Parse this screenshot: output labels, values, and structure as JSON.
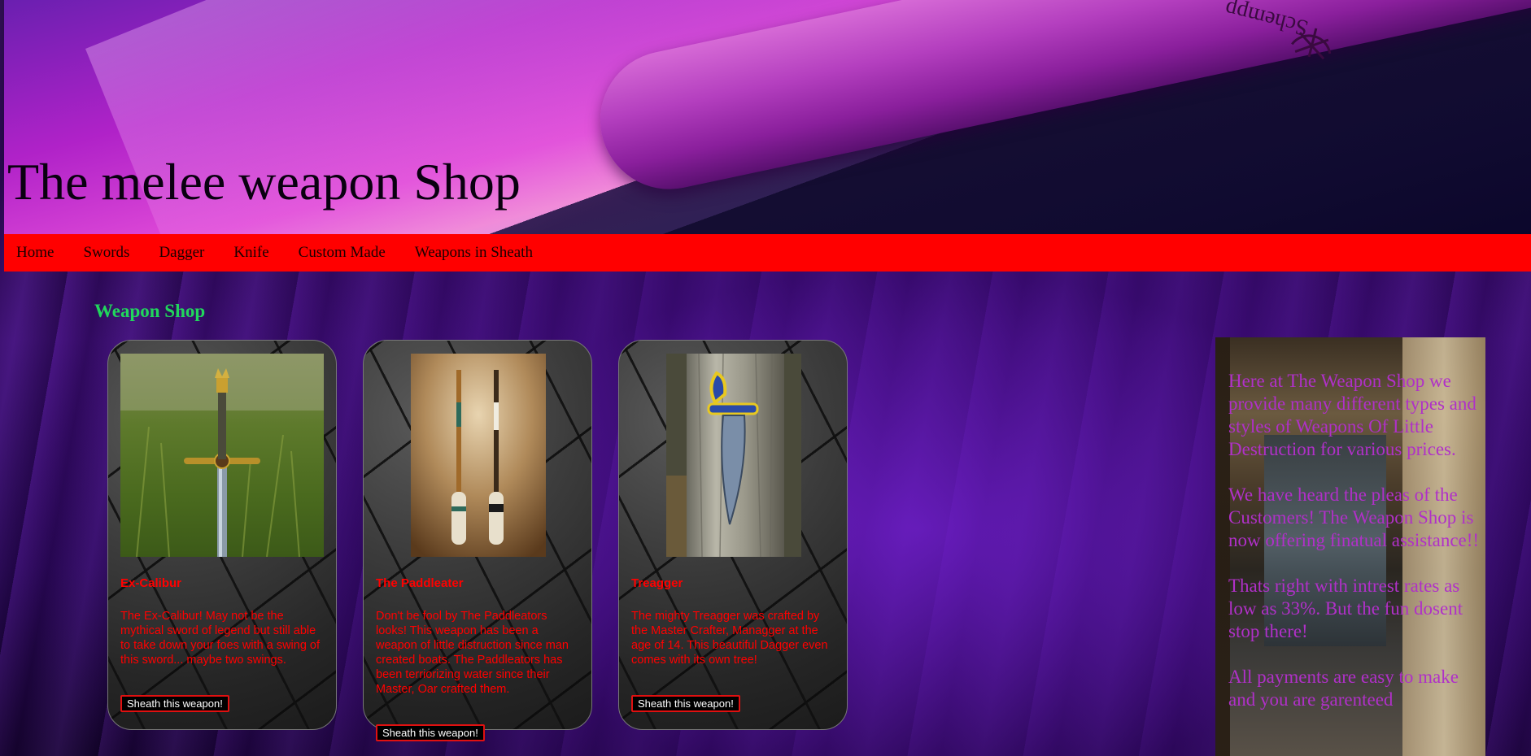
{
  "header": {
    "title": "The melee weapon Shop",
    "brand_mark_text": "Schempp"
  },
  "nav": {
    "items": [
      {
        "label": "Home"
      },
      {
        "label": "Swords"
      },
      {
        "label": "Dagger"
      },
      {
        "label": "Knife"
      },
      {
        "label": "Custom Made"
      },
      {
        "label": "Weapons in Sheath"
      }
    ]
  },
  "main": {
    "heading": "Weapon Shop",
    "products": [
      {
        "name": "Ex-Calibur",
        "description": "The Ex-Calibur! May not be the mythical sword of legend but still able to take down your foes with a swing of this sword... maybe two swings.",
        "button_label": "Sheath this weapon!"
      },
      {
        "name": "The Paddleater",
        "description": "Don't be fool by The Paddleators looks! This weapon has been a weapon of little distruction since man created boats. The Paddleators has been terriorizing water since their Master, Oar crafted them.",
        "button_label": "Sheath this weapon!"
      },
      {
        "name": "Treagger",
        "description": "The mighty Treagger was crafted by the Master Crafter, Managger at the age of 14. This beautiful Dagger even comes with its own tree!",
        "button_label": "Sheath this weapon!"
      }
    ]
  },
  "aside": {
    "paragraphs": [
      "Here at The Weapon Shop we provide many different types and styles of Weapons Of Little Destruction for various prices.",
      "We have heard the pleas of the Customers! The Weapon Shop is now offering finatual assistance!!",
      "Thats right with intrest rates as low as 33%. But the fun dosent stop there!",
      "All payments are easy to make and you are garenteed"
    ]
  }
}
